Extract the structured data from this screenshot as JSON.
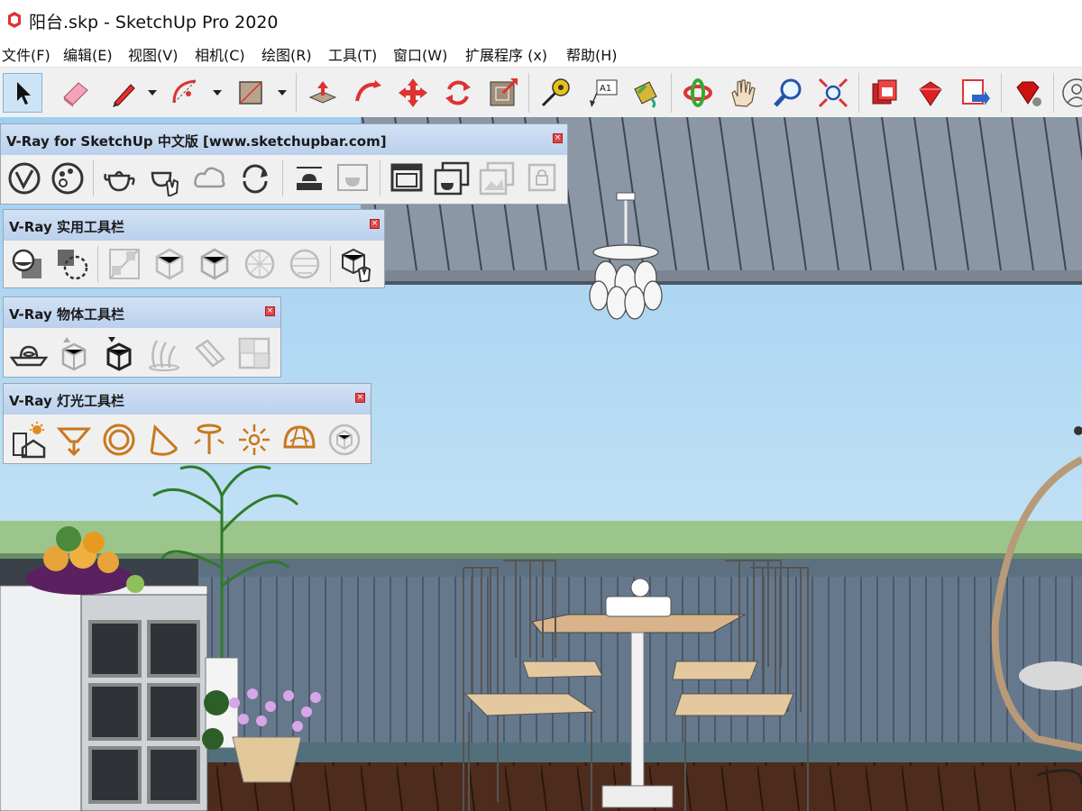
{
  "window": {
    "title": "阳台.skp - SketchUp Pro 2020"
  },
  "menu": {
    "items": [
      "文件(F)",
      "编辑(E)",
      "视图(V)",
      "相机(C)",
      "绘图(R)",
      "工具(T)",
      "窗口(W)",
      "扩展程序 (x)",
      "帮助(H)"
    ]
  },
  "toolbar": {
    "tools": [
      "select-icon",
      "eraser-icon",
      "pencil-line-icon",
      "arc-icon",
      "rectangle-icon",
      "push-pull-icon",
      "follow-me-icon",
      "move-icon",
      "rotate-icon",
      "offset-icon",
      "tape-measure-icon",
      "text-label-icon",
      "paint-bucket-icon",
      "orbit-icon",
      "pan-icon",
      "zoom-icon",
      "zoom-extents-icon",
      "3d-warehouse-icon",
      "extension-warehouse-icon",
      "layout-send-icon",
      "ruby-console-icon",
      "user-account-icon"
    ]
  },
  "palettes": {
    "vray_main": {
      "title": "V-Ray for SketchUp 中文版 [www.sketchupbar.com]"
    },
    "vray_utility": {
      "title": "V-Ray 实用工具栏"
    },
    "vray_object": {
      "title": "V-Ray 物体工具栏"
    },
    "vray_light": {
      "title": "V-Ray 灯光工具栏"
    },
    "close_glyph": "×"
  },
  "colors": {
    "sky": "#a9d4ef",
    "ceiling": "#8a96a4",
    "fence": "#5f7184",
    "floor": "#4a2a1c",
    "grass": "#9cc58c",
    "light_icon": "#c8781e",
    "selection": "#cde4f7"
  }
}
